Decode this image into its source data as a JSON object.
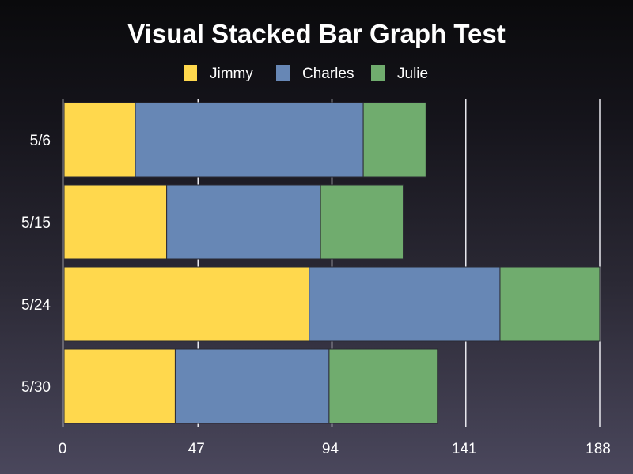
{
  "chart_data": {
    "type": "bar",
    "orientation": "horizontal",
    "stacked": true,
    "title": "Visual Stacked Bar Graph Test",
    "xlabel": "",
    "ylabel": "",
    "categories": [
      "5/6",
      "5/15",
      "5/24",
      "5/30"
    ],
    "series": [
      {
        "name": "Jimmy",
        "color": "#ffd84d",
        "values": [
          25,
          36,
          86,
          39
        ]
      },
      {
        "name": "Charles",
        "color": "#6787b5",
        "values": [
          80,
          54,
          67,
          54
        ]
      },
      {
        "name": "Julie",
        "color": "#70ac6e",
        "values": [
          22,
          29,
          35,
          38
        ]
      }
    ],
    "xlim": [
      0,
      188
    ],
    "xticks": [
      0,
      47,
      94,
      141,
      188
    ],
    "grid": true,
    "legend_position": "top-center"
  }
}
